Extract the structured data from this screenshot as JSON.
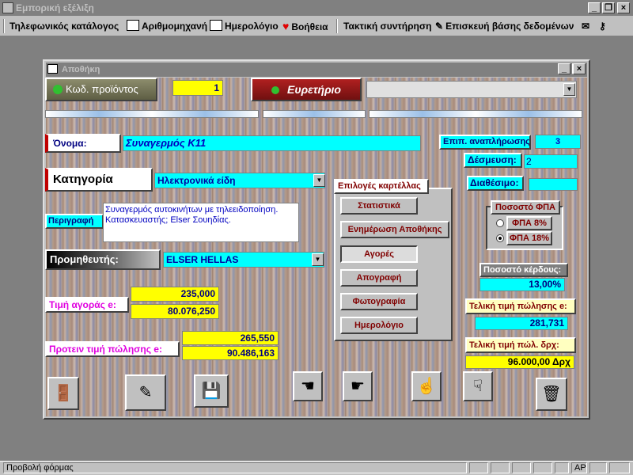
{
  "app": {
    "title": "Εμπορική εξέλιξη"
  },
  "menu": {
    "items": [
      {
        "label": "Τηλεφωνικός κατάλογος"
      },
      {
        "label": "Αριθμομηχανή"
      },
      {
        "label": "Ημερολόγιο"
      },
      {
        "label": "Βοήθεια"
      },
      {
        "label": "Τακτική συντήρηση"
      },
      {
        "label": "Επισκευή βάσης δεδομένων"
      }
    ]
  },
  "form": {
    "title": "Αποθήκη",
    "product_code_label": "Κωδ. προϊόντος",
    "product_code_value": "1",
    "index_button": "Ευρετήριο",
    "name_label": "Όνομα:",
    "name_value": "Συναγερμός Κ11",
    "category_label": "Κατηγορία",
    "category_value": "Ηλεκτρονικά είδη",
    "description_label": "Περιγραφή",
    "description_value": "Συναγερμός αυτοκινήτων με τηλεειδοποίηση. Κατασκευαστής; Elser Σουηδίας.",
    "supplier_label": "Προμηθευτής:",
    "supplier_value": "ELSER HELLAS",
    "purchase_price_label": "Τιμή αγοράς e:",
    "purchase_price_eur": "235,000",
    "purchase_price_drx": "80.076,250",
    "suggested_price_label": "Προτειν τιμή πώλησης e:",
    "suggested_price_eur": "265,550",
    "suggested_price_drx": "90.486,163",
    "reorder_label": "Επιπ. αναπλήρωσης",
    "reorder_value": "3",
    "reserved_label": "Δέσμευση:",
    "reserved_value": "2",
    "available_label": "Διαθέσιμο:",
    "available_value": "",
    "card_options": {
      "title": "Επιλογές καρτέλλας",
      "buttons": [
        "Στατιστικά",
        "Ενημέρωση Αποθήκης",
        "Αγορές",
        "Απογραφή",
        "Φωτογραφία",
        "Ημερολόγιο"
      ]
    },
    "vat": {
      "title": "Ποσοστό ΦΠΑ",
      "opt8": "ΦΠΑ  8%",
      "opt18": "ΦΠΑ 18%",
      "selected": "18"
    },
    "profit_label": "Ποσοστό κέρδους:",
    "profit_value": "13,00%",
    "final_price_eur_label": "Τελική τιμή πώλησης e:",
    "final_price_eur_value": "281,731",
    "final_price_drx_label": "Τελική τιμή πώλ. δρχ:",
    "final_price_drx_value": "96.000,00 Δρχ"
  },
  "status": {
    "text": "Προβολή φόρμας",
    "caps": "ΑΡ"
  },
  "colors": {
    "cyan": "#00ffff",
    "yellow": "#ffff00",
    "titlebar_inactive": "#808080"
  }
}
